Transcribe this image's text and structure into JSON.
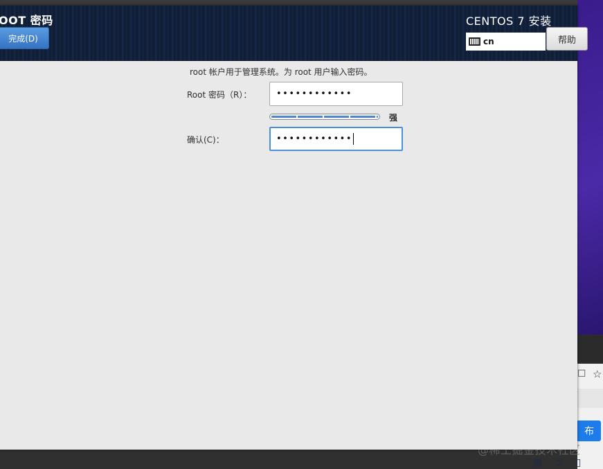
{
  "header": {
    "title": "OOT 密码",
    "done_label": "完成(D)",
    "install_title": "CENTOS 7 安装",
    "keyboard_layout": "cn",
    "help_label": "帮助"
  },
  "form": {
    "description": "root 帐户用于管理系统。为 root 用户输入密码。",
    "root_label": "Root 密码（R）：",
    "root_value": "••••••••••••",
    "strength_fraction": 1.0,
    "strength_label": "强",
    "confirm_label": "确认(C)：",
    "confirm_value": "••••••••••••"
  },
  "background": {
    "publish_label": "布",
    "watermark": "@稀土掘金技术社区",
    "bottom_icons": [
      "document-icon",
      "question-icon",
      "panel-icon"
    ]
  },
  "colors": {
    "accent": "#3573c3",
    "focus": "#4a90d9",
    "header_bg": "#0f1d33"
  }
}
